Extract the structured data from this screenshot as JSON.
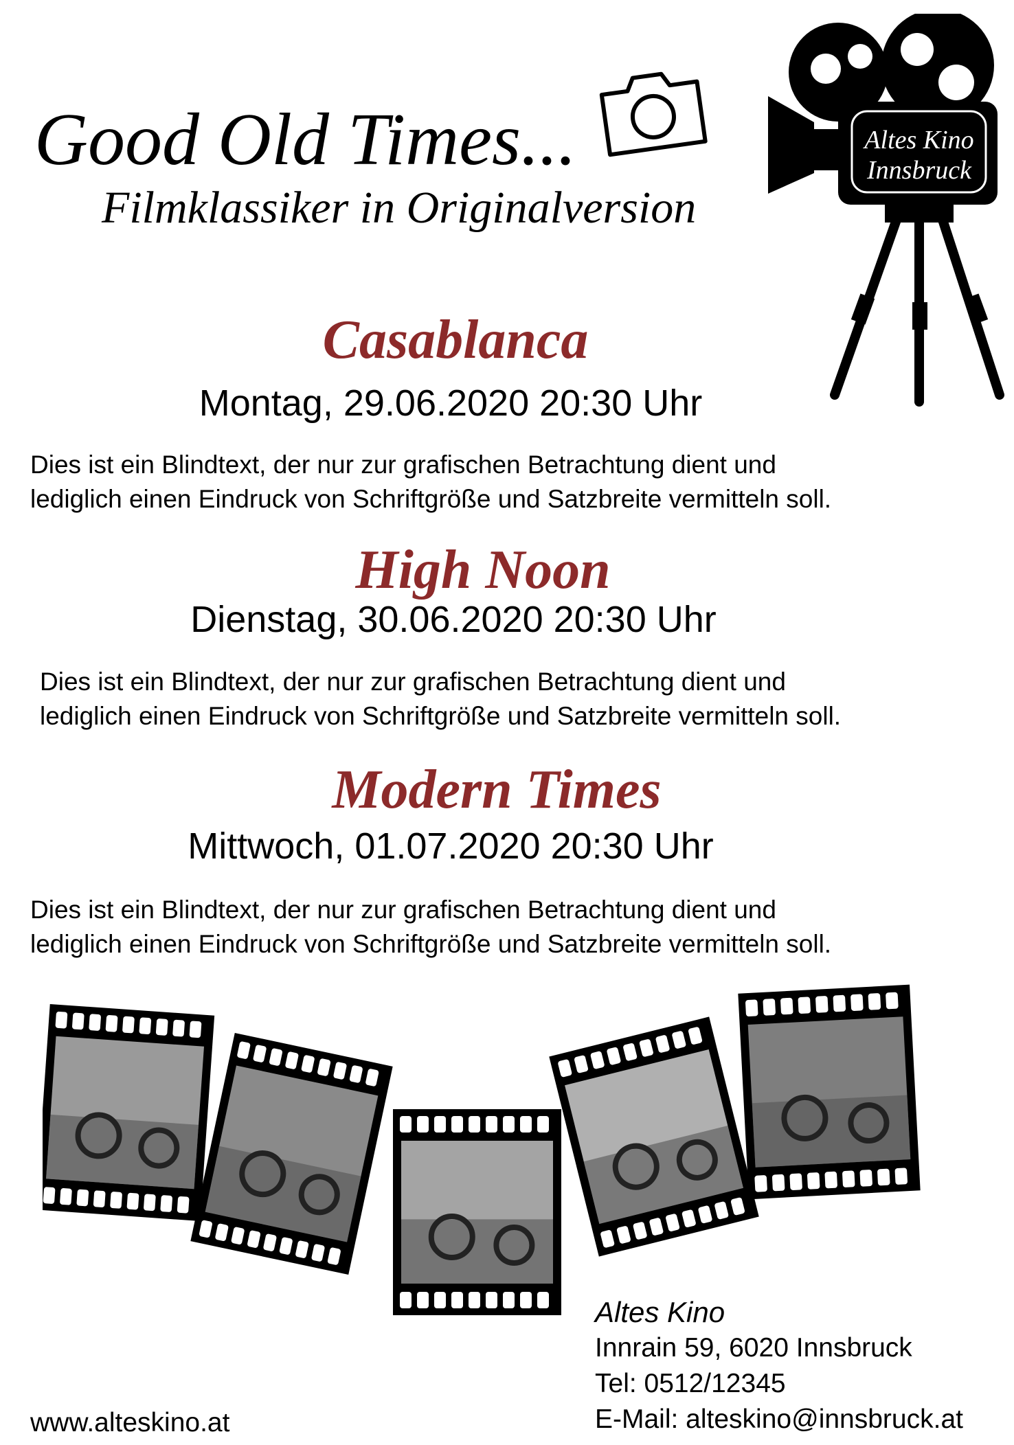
{
  "header": {
    "title": "Good Old Times...",
    "subtitle": "Filmklassiker in Originalversion"
  },
  "logo": {
    "line1": "Altes Kino",
    "line2": "Innsbruck"
  },
  "films": [
    {
      "title": "Casablanca",
      "date": "Montag, 29.06.2020 20:30 Uhr",
      "text_line1": "Dies ist ein Blindtext, der nur zur grafischen Betrachtung dient und",
      "text_line2": "lediglich einen Eindruck von Schriftgröße und Satzbreite vermitteln soll."
    },
    {
      "title": "High Noon",
      "date": "Dienstag, 30.06.2020 20:30 Uhr",
      "text_line1": "Dies ist ein Blindtext, der nur zur grafischen Betrachtung dient und",
      "text_line2": "lediglich einen Eindruck von Schriftgröße und Satzbreite vermitteln soll."
    },
    {
      "title": "Modern Times",
      "date": "Mittwoch, 01.07.2020 20:30 Uhr",
      "text_line1": "Dies ist ein Blindtext, der nur zur grafischen Betrachtung dient und",
      "text_line2": "lediglich einen Eindruck von Schriftgröße und Satzbreite vermitteln soll."
    }
  ],
  "contact": {
    "name": "Altes Kino",
    "address": "Innrain 59, 6020 Innsbruck",
    "phone": "Tel: 0512/12345",
    "email": "E-Mail: alteskino@innsbruck.at"
  },
  "website": "www.alteskino.at",
  "colors": {
    "film_title": "#8c2a2a",
    "text": "#000000",
    "background": "#ffffff"
  },
  "icons": [
    "camera-outline-icon",
    "movie-camera-icon",
    "film-strip-icon"
  ]
}
